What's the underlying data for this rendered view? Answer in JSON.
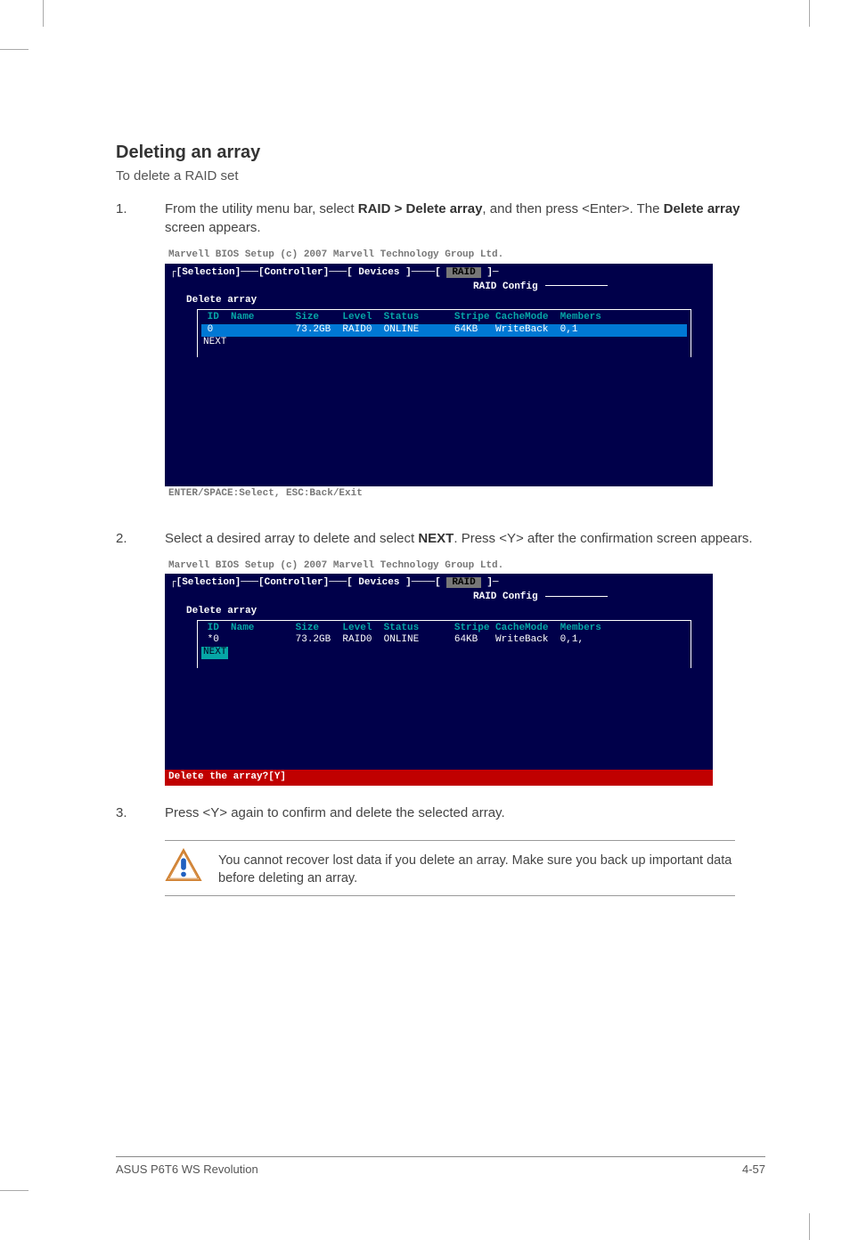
{
  "heading": "Deleting an array",
  "subtitle": "To delete a RAID set",
  "steps": {
    "s1_num": "1.",
    "s1_p1": "From the utility menu bar, select ",
    "s1_b1": "RAID > Delete array",
    "s1_p2": ", and then press <Enter>. The ",
    "s1_b2": "Delete array",
    "s1_p3": " screen appears.",
    "s2_num": "2.",
    "s2_p1": "Select a desired array to delete and select ",
    "s2_b1": "NEXT",
    "s2_p2": ". Press <Y> after the confirmation screen appears.",
    "s3_num": "3.",
    "s3_p1": "Press <Y> again to confirm and delete the selected array."
  },
  "bios": {
    "title": "Marvell BIOS Setup (c) 2007 Marvell Technology Group Ltd.",
    "menu_selection": "[Selection]",
    "menu_controller": "[Controller]",
    "menu_devices": "[ Devices ]",
    "menu_raid": "RAID",
    "sub_raid_config": "RAID Config",
    "box_label": "Delete array",
    "header": " ID  Name       Size    Level  Status      Stripe CacheMode  Members",
    "row1": " 0              73.2GB  RAID0  ONLINE      64KB   WriteBack  0,1",
    "row2": " *0             73.2GB  RAID0  ONLINE      64KB   WriteBack  0,1,",
    "next": "NEXT",
    "footer1": "ENTER/SPACE:Select, ESC:Back/Exit",
    "footer2": "Delete the array?[Y]"
  },
  "callout": "You cannot recover lost data if you delete an array. Make sure you back up important data before deleting an array.",
  "footer_left": "ASUS P6T6 WS Revolution",
  "footer_right": "4-57"
}
